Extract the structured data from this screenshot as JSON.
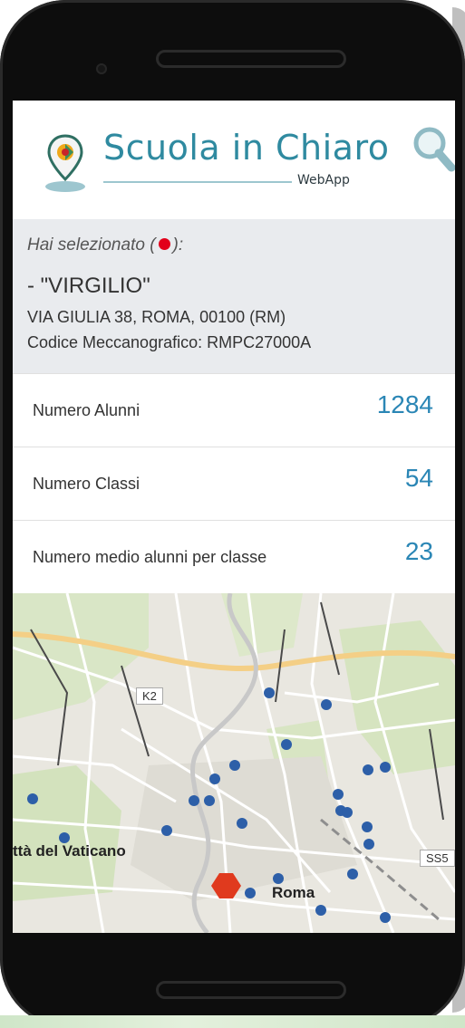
{
  "app": {
    "title": "Scuola in Chiaro",
    "subtitle": "WebApp"
  },
  "icons": {
    "search": "search-icon",
    "logo": "location-pin-icon"
  },
  "selection": {
    "intro_prefix": "Hai selezionato (",
    "intro_suffix": "):",
    "school_name": "- \"VIRGILIO\"",
    "address": "VIA GIULIA 38, ROMA, 00100 (RM)",
    "code": "Codice Meccanografico: RMPC27000A"
  },
  "stats": [
    {
      "label": "Numero Alunni",
      "value": "1284"
    },
    {
      "label": "Numero Classi",
      "value": "54"
    },
    {
      "label": "Numero medio alunni per classe",
      "value": "23"
    }
  ],
  "map": {
    "labels": {
      "vatican": "ttà del Vaticano",
      "roma": "Roma",
      "k2": "K2",
      "ss5": "SS5"
    }
  },
  "colors": {
    "brand": "#2f8aa0",
    "value_blue": "#2a86b5",
    "selected_marker": "#e03a1e",
    "school_dot": "#2d5fa8"
  }
}
